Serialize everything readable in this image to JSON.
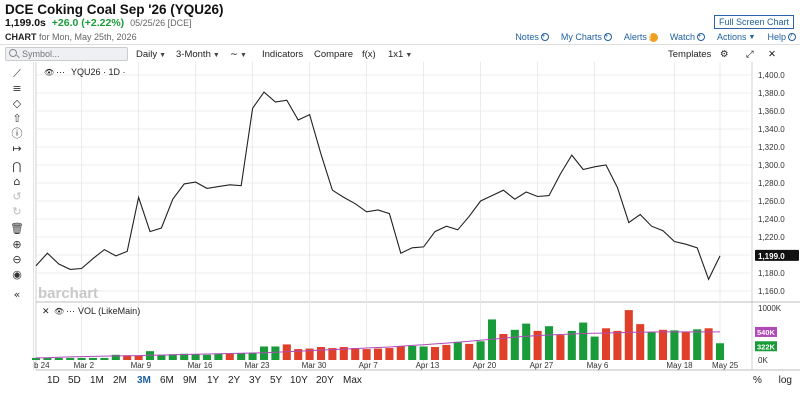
{
  "header": {
    "title": "DCE Coking Coal Sep '26 (YQU26)",
    "last": "1,199.0s",
    "change": "+26.0 (+2.22%)",
    "date": "05/25/26 [DCE]",
    "chart_for_bold": "CHART",
    "chart_for_rest": "for Mon, May 25th, 2026",
    "fullscreen": "Full Screen Chart",
    "notes": "Notes",
    "my_charts": "My Charts",
    "alerts": "Alerts",
    "alerts_count": "!",
    "watch": "Watch",
    "actions": "Actions",
    "help": "Help"
  },
  "toolbar": {
    "symbol_placeholder": "Symbol...",
    "interval": "Daily",
    "range": "3-Month",
    "chart_style": "∼",
    "indicators": "Indicators",
    "compare": "Compare",
    "fx": "f(x)",
    "layout": "1x1",
    "templates": "Templates"
  },
  "legend": {
    "price": "YQU26 · 1D ·",
    "volume": "VOL (LikeMain)"
  },
  "price_axis": {
    "ticks": [
      "1,400.0",
      "1,380.0",
      "1,360.0",
      "1,340.0",
      "1,320.0",
      "1,300.0",
      "1,280.0",
      "1,260.0",
      "1,240.0",
      "1,220.0",
      "1,200.0",
      "1,180.0",
      "1,160.0"
    ],
    "last_label": "1,199.0"
  },
  "volume_axis": {
    "ticks": [
      "1000K",
      "500K",
      "0K"
    ],
    "ma_label": "540K",
    "last_label": "322K"
  },
  "x_axis": {
    "labels": [
      "b 24",
      "Mar 2",
      "Mar 9",
      "Mar 16",
      "Mar 23",
      "Mar 30",
      "Apr 7",
      "Apr 13",
      "Apr 20",
      "Apr 27",
      "May 6",
      "May 18",
      "May 25"
    ]
  },
  "watermark": "barchart",
  "timeframes": [
    "1D",
    "5D",
    "1M",
    "2M",
    "3M",
    "6M",
    "9M",
    "1Y",
    "2Y",
    "3Y",
    "5Y",
    "10Y",
    "20Y",
    "Max"
  ],
  "timeframe_active": "3M",
  "bottom_right": {
    "pct": "%",
    "log": "log"
  },
  "colors": {
    "up": "#1a9b3a",
    "down": "#e0402a",
    "ma": "#b04ab8",
    "accent": "#1f5f9e"
  },
  "chart_data": {
    "type": "line",
    "title": "DCE Coking Coal Sep '26 (YQU26)",
    "ylim": [
      1150,
      1410
    ],
    "closes": [
      1188,
      1202,
      1190,
      1184,
      1185,
      1196,
      1206,
      1199,
      1204,
      1264,
      1226,
      1230,
      1262,
      1279,
      1281,
      1274,
      1276,
      1278,
      1277,
      1363,
      1381,
      1370,
      1372,
      1350,
      1356,
      1312,
      1272,
      1264,
      1257,
      1248,
      1250,
      1246,
      1202,
      1208,
      1209,
      1226,
      1232,
      1228,
      1243,
      1260,
      1266,
      1272,
      1262,
      1270,
      1265,
      1266,
      1290,
      1311,
      1295,
      1298,
      1300,
      1275,
      1236,
      1245,
      1232,
      1227,
      1215,
      1212,
      1208,
      1173,
      1199
    ],
    "volume": {
      "ylim": [
        0,
        1000
      ],
      "unit": "K",
      "values": [
        40,
        40,
        40,
        40,
        40,
        40,
        40,
        100,
        90,
        80,
        170,
        100,
        110,
        120,
        110,
        100,
        120,
        120,
        130,
        140,
        260,
        260,
        300,
        210,
        220,
        250,
        230,
        250,
        230,
        210,
        220,
        230,
        270,
        270,
        260,
        250,
        290,
        350,
        310,
        360,
        780,
        500,
        580,
        700,
        560,
        650,
        480,
        560,
        720,
        450,
        610,
        560,
        960,
        690,
        530,
        580,
        570,
        540,
        590,
        610,
        322
      ],
      "up": [
        true,
        true,
        true,
        true,
        true,
        true,
        true,
        true,
        false,
        false,
        true,
        true,
        true,
        true,
        true,
        true,
        true,
        false,
        true,
        true,
        true,
        true,
        false,
        false,
        false,
        false,
        false,
        false,
        false,
        false,
        false,
        false,
        false,
        true,
        true,
        false,
        false,
        true,
        false,
        true,
        true,
        false,
        true,
        true,
        false,
        true,
        false,
        true,
        true,
        true,
        false,
        false,
        false,
        false,
        true,
        false,
        true,
        false,
        true,
        false,
        true
      ],
      "ma": [
        40,
        45,
        52,
        60,
        65,
        70,
        75,
        78,
        80,
        85,
        90,
        95,
        100,
        105,
        110,
        115,
        120,
        125,
        130,
        135,
        140,
        150,
        160,
        170,
        180,
        190,
        200,
        210,
        220,
        230,
        240,
        250,
        265,
        280,
        295,
        310,
        325,
        340,
        360,
        380,
        400,
        420,
        440,
        455,
        470,
        480,
        490,
        500,
        510,
        515,
        520,
        525,
        530,
        535,
        538,
        540,
        540,
        540,
        540,
        540,
        540
      ]
    }
  }
}
